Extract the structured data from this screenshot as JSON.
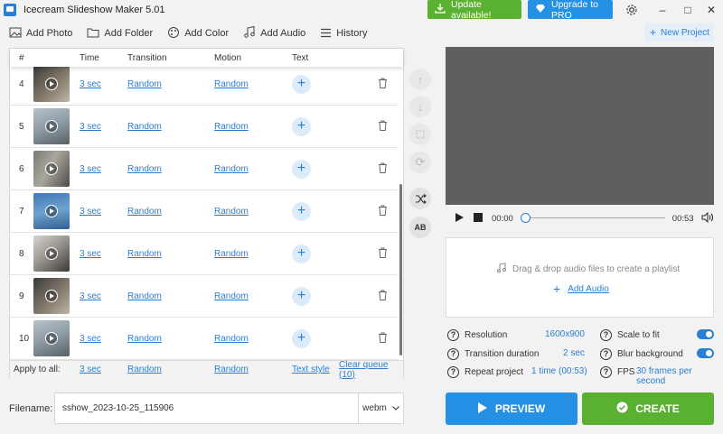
{
  "app": {
    "title": "Icecream Slideshow Maker 5.01"
  },
  "header": {
    "update_label": "Update available!",
    "pro_label": "Upgrade to PRO",
    "accent_green": "#5ab031",
    "accent_blue": "#2491e5"
  },
  "toolbar": {
    "add_photo": "Add Photo",
    "add_folder": "Add Folder",
    "add_color": "Add Color",
    "add_audio": "Add Audio",
    "history": "History",
    "new_project": "New Project"
  },
  "table": {
    "headers": {
      "num": "#",
      "time": "Time",
      "transition": "Transition",
      "motion": "Motion",
      "text": "Text"
    },
    "rows": [
      {
        "num": "4",
        "time": "3 sec",
        "transition": "Random",
        "motion": "Random"
      },
      {
        "num": "5",
        "time": "3 sec",
        "transition": "Random",
        "motion": "Random"
      },
      {
        "num": "6",
        "time": "3 sec",
        "transition": "Random",
        "motion": "Random"
      },
      {
        "num": "7",
        "time": "3 sec",
        "transition": "Random",
        "motion": "Random"
      },
      {
        "num": "8",
        "time": "3 sec",
        "transition": "Random",
        "motion": "Random"
      },
      {
        "num": "9",
        "time": "3 sec",
        "transition": "Random",
        "motion": "Random"
      },
      {
        "num": "10",
        "time": "3 sec",
        "transition": "Random",
        "motion": "Random"
      }
    ],
    "footer": {
      "apply_all": "Apply to all:",
      "time": "3 sec",
      "transition": "Random",
      "motion": "Random",
      "text_style": "Text style",
      "clear_queue": "Clear queue (10)"
    }
  },
  "player": {
    "current_time": "00:00",
    "total_time": "00:53"
  },
  "audio": {
    "drop_hint": "Drag & drop audio files to create a playlist",
    "add_audio": "Add Audio"
  },
  "settings": {
    "resolution_label": "Resolution",
    "resolution_value": "1600x900",
    "transition_label": "Transition duration",
    "transition_value": "2 sec",
    "repeat_label": "Repeat project",
    "repeat_value": "1 time (00:53)",
    "scale_label": "Scale to fit",
    "scale_on": true,
    "blur_label": "Blur background",
    "blur_on": true,
    "fps_label": "FPS",
    "fps_value": "30 frames per second"
  },
  "output": {
    "filename_label": "Filename:",
    "filename_value": "sshow_2023-10-25_115906",
    "format": "webm",
    "preview_label": "PREVIEW",
    "create_label": "CREATE"
  }
}
